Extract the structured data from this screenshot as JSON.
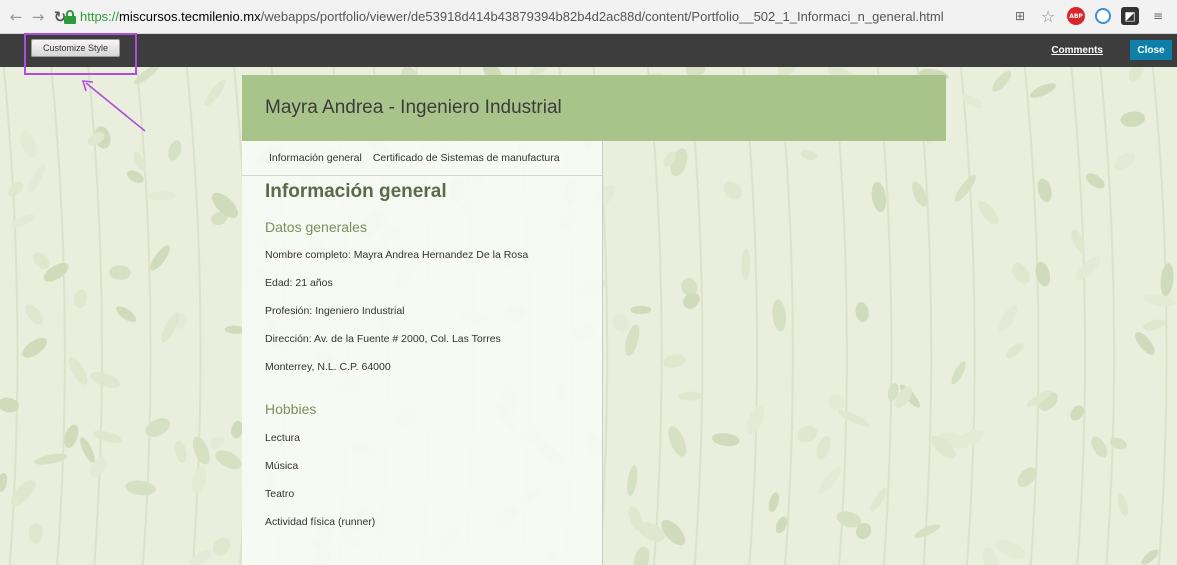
{
  "browser": {
    "url_scheme": "https://",
    "url_host": "miscursos.tecmilenio.mx",
    "url_path": "/webapps/portfolio/viewer/de53918d414b43879394b82b4d2ac88d/content/Portfolio__502_1_Informaci_n_general.html",
    "nav_icons": [
      "back-arrow-icon",
      "forward-arrow-icon",
      "reload-icon"
    ],
    "extension_icons": [
      "translate-icon",
      "star-icon",
      "adblock-icon",
      "sync-icon",
      "extension-icon",
      "menu-icon"
    ],
    "abp_label": "ABP"
  },
  "toolbar": {
    "customize_label": "Customize Style",
    "comments_label": "Comments",
    "close_label": "Close"
  },
  "colors": {
    "banner": "#a9c48a",
    "toolbar": "#3d3d3d",
    "close_button": "#0d7fa8",
    "highlight": "#b04de0",
    "background": "#e9eedd"
  },
  "portfolio": {
    "title": "Mayra Andrea - Ingeniero Industrial",
    "tabs": [
      {
        "label": "Información general"
      },
      {
        "label": "Certificado de Sistemas de manufactura"
      }
    ],
    "heading": "Información general",
    "sections": [
      {
        "title": "Datos generales",
        "lines": [
          "Nombre completo: Mayra Andrea Hernandez De la Rosa",
          "Edad: 21 años",
          "Profesión: Ingeniero Industrial",
          "Dirección: Av. de la Fuente # 2000, Col. Las Torres",
          "Monterrey, N.L. C.P. 64000"
        ]
      },
      {
        "title": "Hobbies",
        "lines": [
          "Lectura",
          "Música",
          "Teatro",
          "Actividad física (runner)"
        ]
      }
    ]
  }
}
